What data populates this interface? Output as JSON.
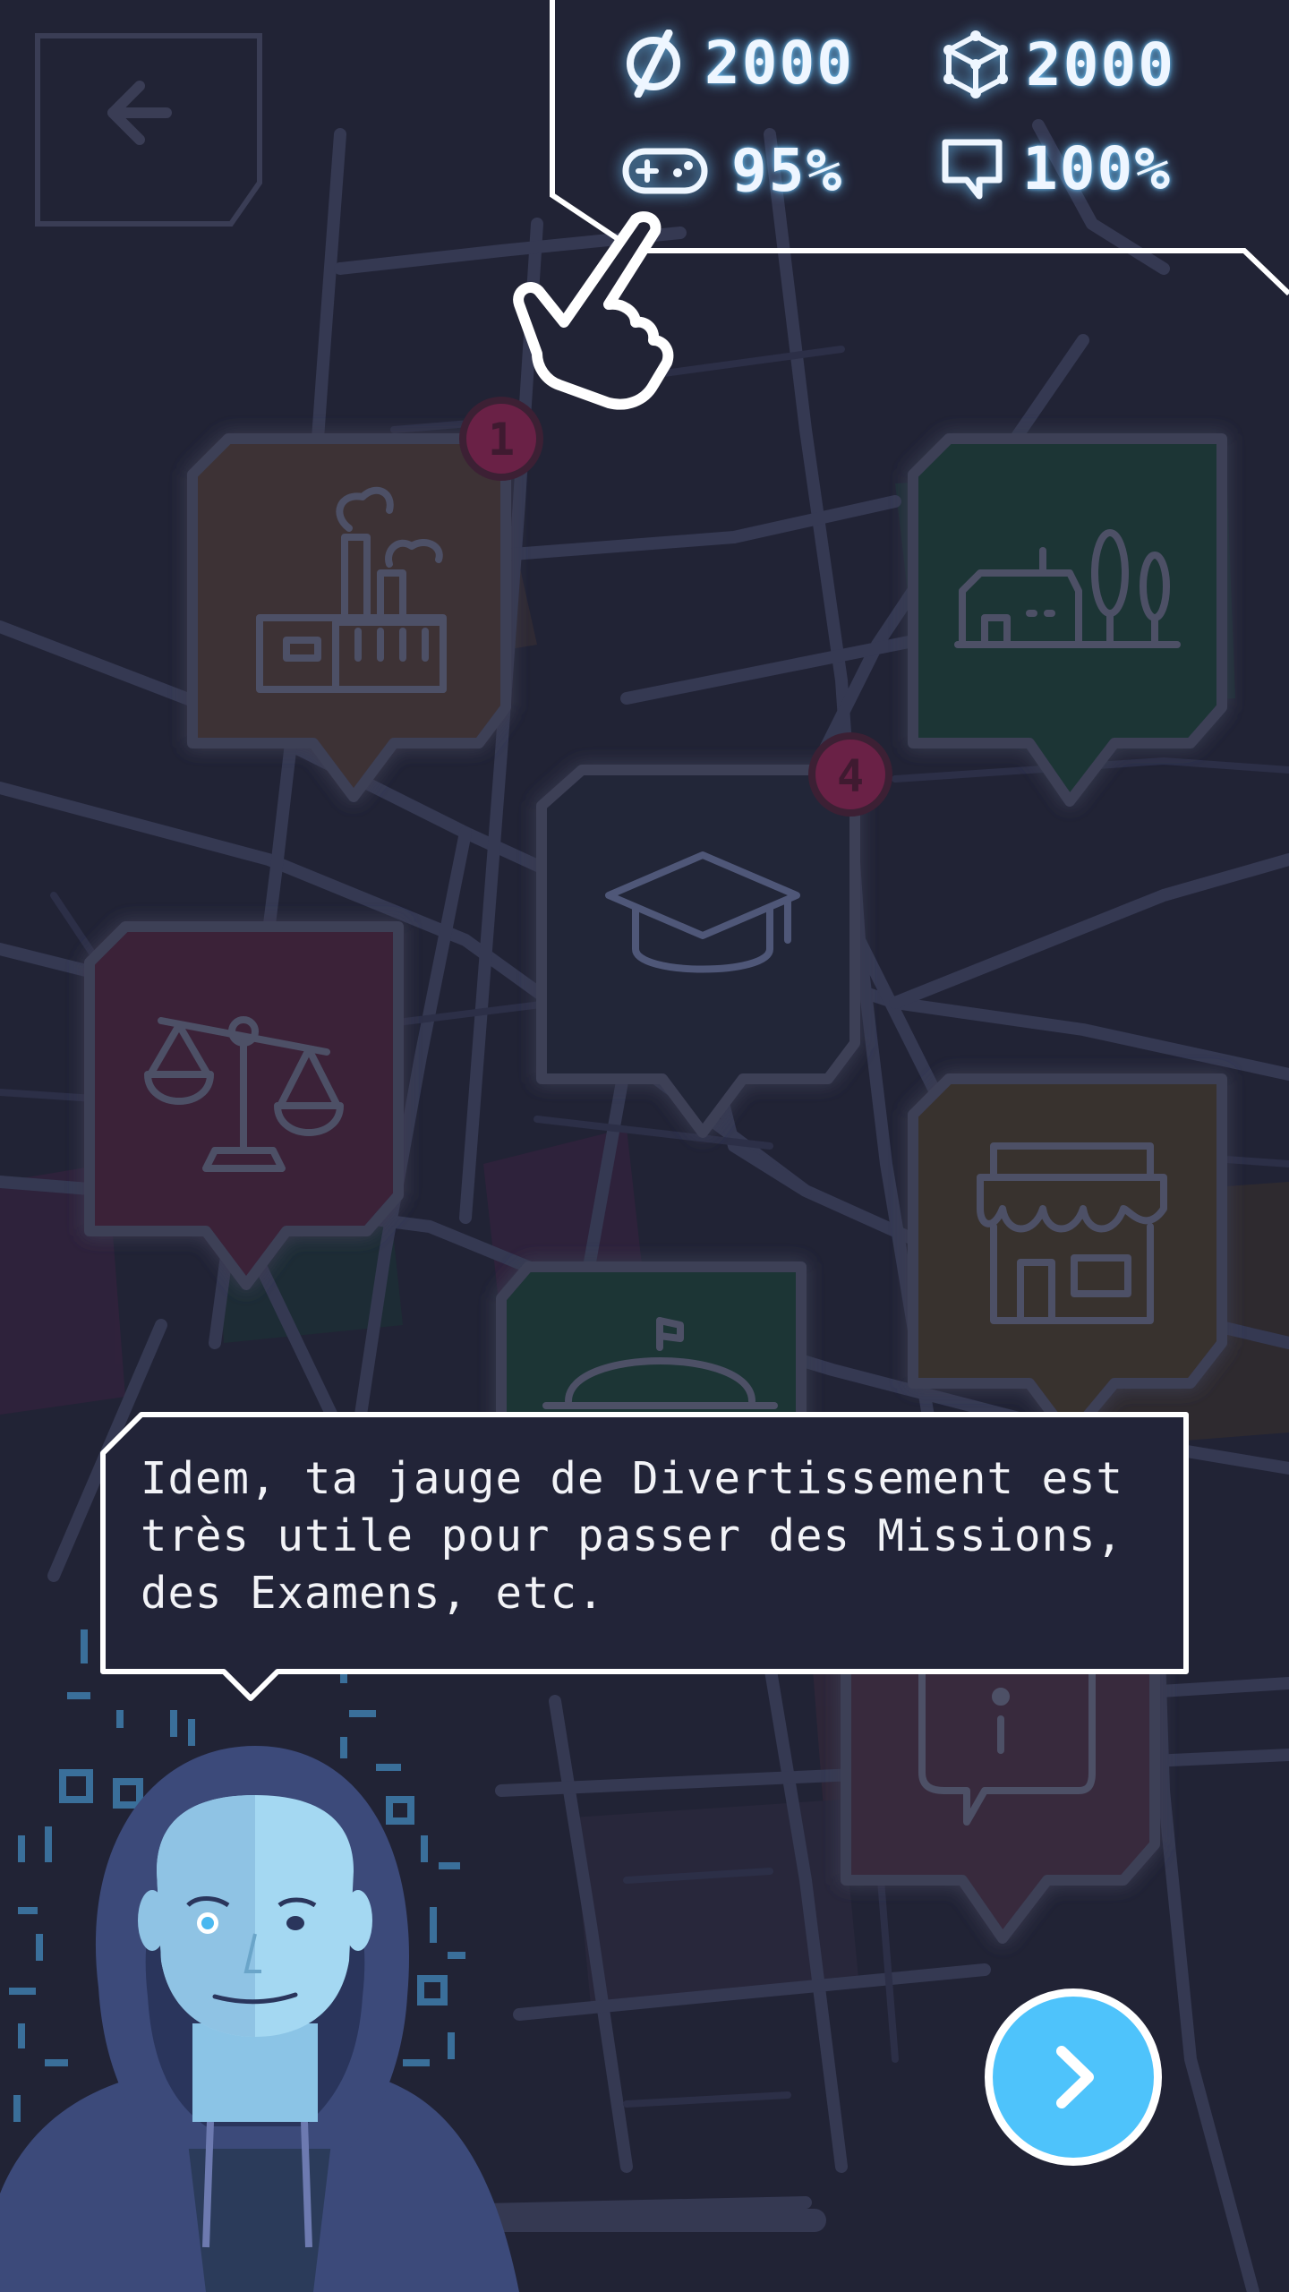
{
  "hud": {
    "stats": [
      {
        "icon": "credits-icon",
        "value": "2000"
      },
      {
        "icon": "data-cube-icon",
        "value": "2000"
      },
      {
        "icon": "gamepad-icon",
        "value": "95%"
      },
      {
        "icon": "chat-bubble-icon",
        "value": "100%"
      }
    ]
  },
  "map": {
    "pins": [
      {
        "name": "factory-pin",
        "icon": "factory-icon",
        "badge": "1",
        "color": "#4a3433"
      },
      {
        "name": "housing-pin",
        "icon": "house-trees-icon",
        "color": "#1f3a3c"
      },
      {
        "name": "school-pin",
        "icon": "graduation-cap-icon",
        "badge": "4",
        "color": "#252841"
      },
      {
        "name": "justice-pin",
        "icon": "scales-icon",
        "color": "#3f2540"
      },
      {
        "name": "shop-pin",
        "icon": "store-icon",
        "color": "#3b3130"
      },
      {
        "name": "service-pin",
        "icon": "service-bell-icon",
        "color": "#1f3a3c"
      },
      {
        "name": "info-pin",
        "icon": "info-icon",
        "color": "#3b2c40"
      }
    ]
  },
  "dialog": {
    "text": "Idem, ta jauge de Divertissement est\ntrès utile pour passer des Missions,\ndes Examens, etc."
  },
  "colors": {
    "background": "#212335",
    "road": "#343853",
    "accent": "#4ec3fb",
    "badge": "#6a2146"
  }
}
